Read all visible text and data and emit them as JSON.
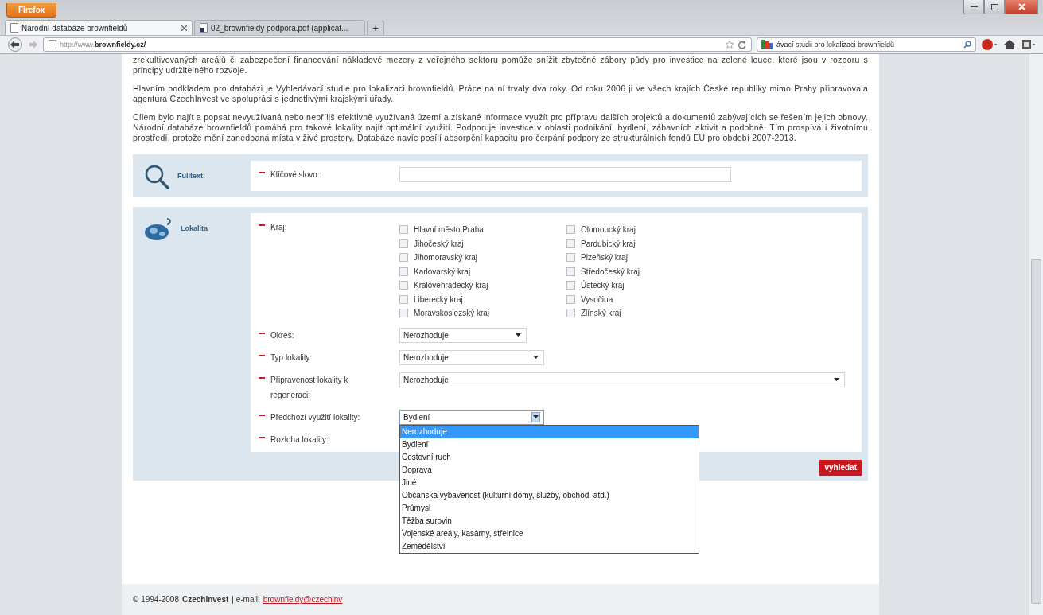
{
  "browser": {
    "menu_button": "Firefox",
    "tabs": [
      {
        "title": "Národní databáze brownfieldů",
        "selected": true
      },
      {
        "title": "02_brownfieldy podpora.pdf (applicat...",
        "selected": false
      }
    ],
    "new_tab": "+",
    "url": {
      "prefix": "http://www.",
      "domain": "brownfieldy.cz/"
    },
    "search": "ávací studii pro lokalizaci brownfieldů"
  },
  "paragraphs": [
    "zrekultivovaných areálů či zabezpečení financování nákladové mezery z veřejného sektoru pomůže snížit zbytečné zábory půdy pro investice na zelené louce, které jsou v rozporu s principy udržitelného rozvoje.",
    "Hlavním podkladem pro databázi je Vyhledávací studie pro lokalizaci brownfieldů. Práce na ní trvaly dva roky. Od roku 2006 ji ve všech krajích České republiky mimo Prahy připravovala agentura CzechInvest ve spolupráci s jednotlivými krajskými úřady.",
    "Cílem bylo najít a popsat nevyužívaná nebo nepříliš efektivně využívaná území a získané informace využít pro přípravu dalších projektů a dokumentů zabývajících se řešením jejich obnovy. Národní databáze brownfieldů pomáhá pro takové lokality najít optimální využití. Podporuje investice v oblasti podnikání, bydlení, zábavních aktivit a podobně. Tím prospívá i životnímu prostředí, protože mění zanedbaná místa v živé prostory. Databáze navíc posílí absorpční kapacitu pro čerpání podpory ze strukturálních fondů EU pro období 2007-2013."
  ],
  "fulltext": {
    "label": "Fulltext:",
    "field_label": "Klíčové slovo:"
  },
  "lokalita": {
    "label": "Lokalita",
    "kraj_label": "Kraj:",
    "regions": [
      {
        "name": "Hlavní město Praha",
        "checked": false
      },
      {
        "name": "Jihočeský kraj",
        "checked": false
      },
      {
        "name": "Jihomoravský kraj",
        "checked": false
      },
      {
        "name": "Karlovarský kraj",
        "checked": false
      },
      {
        "name": "Královéhradecký kraj",
        "checked": false
      },
      {
        "name": "Liberecký kraj",
        "checked": false
      },
      {
        "name": "Moravskoslezský kraj",
        "checked": false
      },
      {
        "name": "Olomoucký kraj",
        "checked": false
      },
      {
        "name": "Pardubický kraj",
        "checked": false
      },
      {
        "name": "Plzeňský kraj",
        "checked": false
      },
      {
        "name": "Středočeský kraj",
        "checked": false
      },
      {
        "name": "Ústecký kraj",
        "checked": false
      },
      {
        "name": "Vysočina",
        "checked": false
      },
      {
        "name": "Zlínský kraj",
        "checked": false
      }
    ],
    "selects": [
      {
        "label": "Okres:",
        "value": "Nerozhoduje",
        "kind": "short"
      },
      {
        "label": "Typ lokality:",
        "value": "Nerozhoduje",
        "kind": "medium"
      },
      {
        "label": "Připravenost lokality k regeneraci:",
        "value": "Nerozhoduje",
        "kind": "wide"
      },
      {
        "label": "Předchozí využití lokality:",
        "value": "Bydlení",
        "kind": "medium",
        "options": [
          {
            "label": "Nerozhoduje",
            "highlighted": true
          },
          {
            "label": "Bydlení",
            "highlighted": false
          },
          {
            "label": "Cestovní ruch",
            "highlighted": false
          },
          {
            "label": "Doprava",
            "highlighted": false
          },
          {
            "label": "Jiné",
            "highlighted": false
          },
          {
            "label": "Občanská vybavenost (kulturní domy, služby, obchod, atd.)",
            "highlighted": false
          },
          {
            "label": "Průmysl",
            "highlighted": false
          },
          {
            "label": "Těžba surovin",
            "highlighted": false
          },
          {
            "label": "Vojenské areály, kasárny, střelnice",
            "highlighted": false
          },
          {
            "label": "Zemědělství",
            "highlighted": false
          }
        ]
      },
      {
        "label": "Rozloha lokality:",
        "kind": "none"
      }
    ],
    "submit": "vyhledat"
  },
  "footer": {
    "copyright": "© 1994-2008",
    "company": "CzechInvest",
    "separator": "| e-mail:",
    "email": "brownfieldy@czechinv"
  }
}
